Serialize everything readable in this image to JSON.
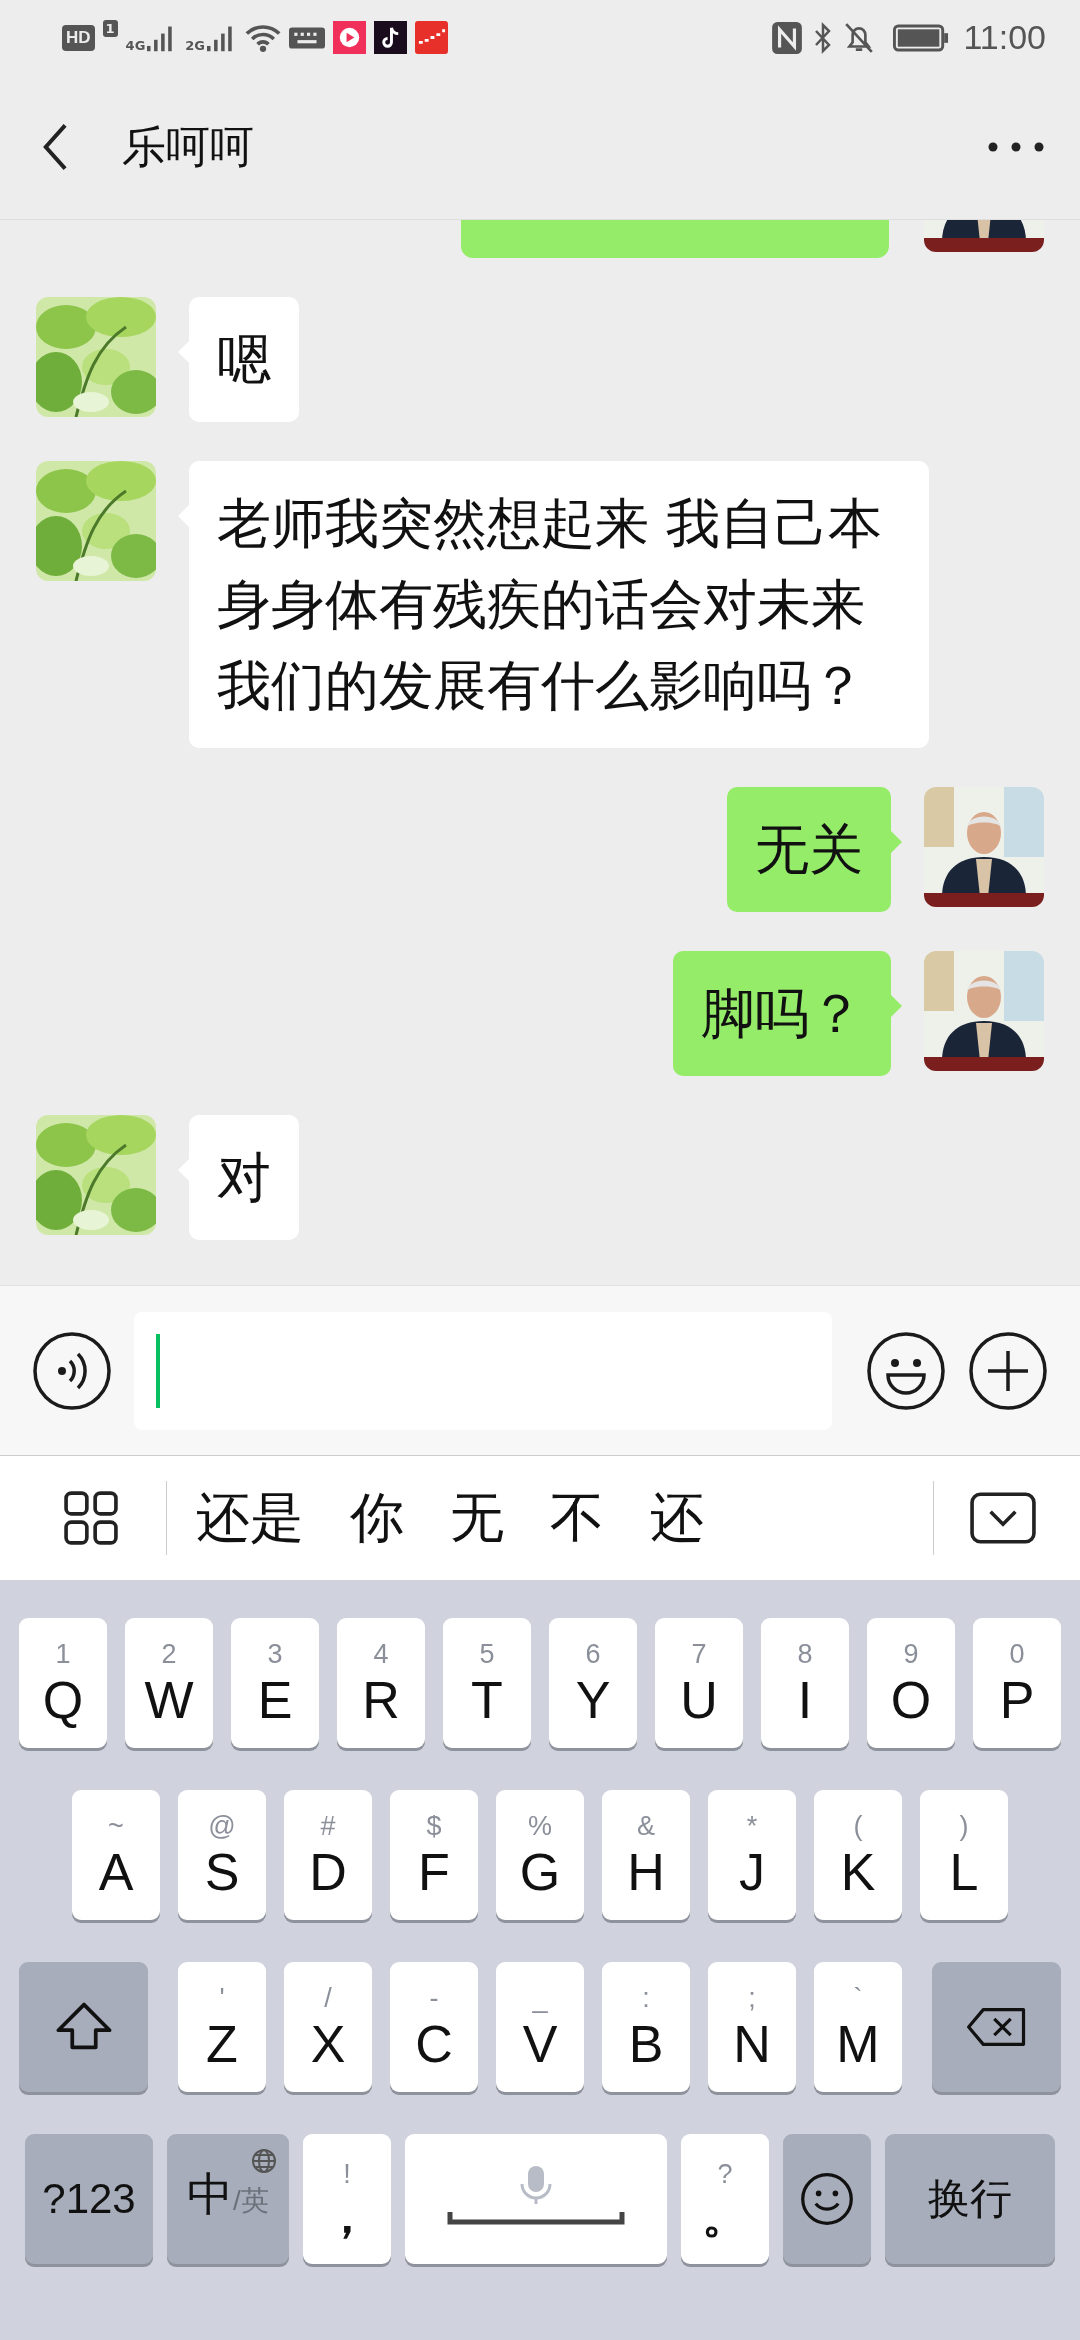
{
  "status_bar": {
    "hd": "HD",
    "sim": "1",
    "signals": [
      {
        "label": "4G"
      },
      {
        "label": "2G"
      }
    ],
    "time": "11:00"
  },
  "header": {
    "title": "乐呵呵"
  },
  "messages": [
    {
      "outgoing": true,
      "kind": "cut"
    },
    {
      "outgoing": false,
      "kind": "text",
      "text": "嗯"
    },
    {
      "outgoing": false,
      "kind": "text",
      "text": "老师我突然想起来 我自己本身身体有残疾的话会对未来我们的发展有什么影响吗？"
    },
    {
      "outgoing": true,
      "kind": "text",
      "text": "无关"
    },
    {
      "outgoing": true,
      "kind": "text",
      "text": "脚吗？"
    },
    {
      "outgoing": false,
      "kind": "text",
      "text": "对"
    }
  ],
  "candidates": [
    "还是",
    "你",
    "无",
    "不",
    "还"
  ],
  "keyboard": {
    "rows": [
      [
        {
          "kind": "letter",
          "label": "Q",
          "hint": "1"
        },
        {
          "kind": "letter",
          "label": "W",
          "hint": "2"
        },
        {
          "kind": "letter",
          "label": "E",
          "hint": "3"
        },
        {
          "kind": "letter",
          "label": "R",
          "hint": "4"
        },
        {
          "kind": "letter",
          "label": "T",
          "hint": "5"
        },
        {
          "kind": "letter",
          "label": "Y",
          "hint": "6"
        },
        {
          "kind": "letter",
          "label": "U",
          "hint": "7"
        },
        {
          "kind": "letter",
          "label": "I",
          "hint": "8"
        },
        {
          "kind": "letter",
          "label": "O",
          "hint": "9"
        },
        {
          "kind": "letter",
          "label": "P",
          "hint": "0"
        }
      ],
      [
        {
          "kind": "letter",
          "label": "A",
          "hint": "~"
        },
        {
          "kind": "letter",
          "label": "S",
          "hint": "@"
        },
        {
          "kind": "letter",
          "label": "D",
          "hint": "#"
        },
        {
          "kind": "letter",
          "label": "F",
          "hint": "$"
        },
        {
          "kind": "letter",
          "label": "G",
          "hint": "%"
        },
        {
          "kind": "letter",
          "label": "H",
          "hint": "&"
        },
        {
          "kind": "letter",
          "label": "J",
          "hint": "*"
        },
        {
          "kind": "letter",
          "label": "K",
          "hint": "("
        },
        {
          "kind": "letter",
          "label": "L",
          "hint": ")"
        }
      ],
      [
        {
          "kind": "shift"
        },
        {
          "kind": "letter",
          "label": "Z",
          "hint": "'"
        },
        {
          "kind": "letter",
          "label": "X",
          "hint": "/"
        },
        {
          "kind": "letter",
          "label": "C",
          "hint": "-"
        },
        {
          "kind": "letter",
          "label": "V",
          "hint": "_"
        },
        {
          "kind": "letter",
          "label": "B",
          "hint": ":"
        },
        {
          "kind": "letter",
          "label": "N",
          "hint": ";"
        },
        {
          "kind": "letter",
          "label": "M",
          "hint": "`"
        },
        {
          "kind": "delete"
        }
      ],
      [
        {
          "kind": "symbols",
          "label": "?123"
        },
        {
          "kind": "lang",
          "label": "中",
          "hint": "/英"
        },
        {
          "kind": "punct",
          "label": "，",
          "hint": "!"
        },
        {
          "kind": "space"
        },
        {
          "kind": "punct",
          "label": "。",
          "hint": "?"
        },
        {
          "kind": "emoji"
        },
        {
          "kind": "enter",
          "label": "换行"
        }
      ]
    ]
  }
}
